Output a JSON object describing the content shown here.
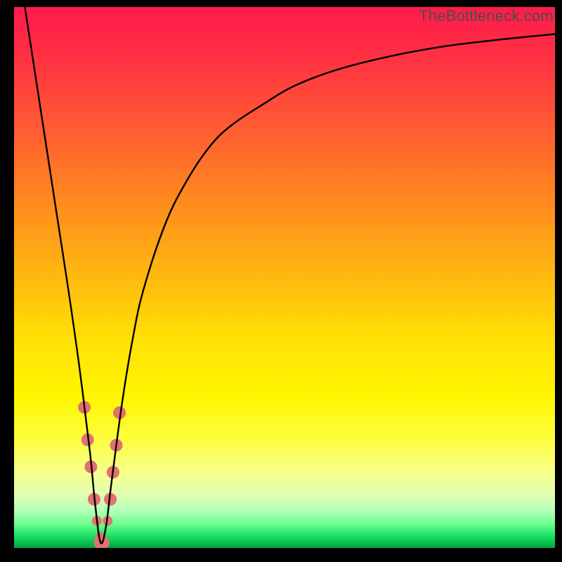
{
  "watermark": {
    "text": "TheBottleneck.com"
  },
  "colors": {
    "curve": "#000000",
    "marker": "#e37070",
    "markerStroke": "#d45a5a",
    "frame": "#000000"
  },
  "chart_data": {
    "type": "line",
    "title": "",
    "xlabel": "",
    "ylabel": "",
    "xlim": [
      0,
      100
    ],
    "ylim": [
      0,
      100
    ],
    "grid": false,
    "legend": null,
    "series": [
      {
        "name": "bottleneck-curve",
        "x": [
          2,
          4,
          6,
          8,
          10,
          12,
          14,
          15,
          16,
          17,
          18,
          20,
          22,
          24,
          28,
          32,
          36,
          40,
          46,
          52,
          60,
          70,
          80,
          90,
          100
        ],
        "y": [
          100,
          87,
          74,
          61,
          48,
          34,
          18,
          8,
          1,
          4,
          12,
          27,
          39,
          48,
          60,
          68,
          74,
          78,
          82,
          85.5,
          88.5,
          91,
          92.8,
          94,
          95
        ]
      }
    ],
    "markers": {
      "name": "highlight-dots",
      "x": [
        13.0,
        13.6,
        14.2,
        14.8,
        15.3,
        15.9,
        16.2,
        17.3,
        17.8,
        18.3,
        18.9,
        19.5
      ],
      "y": [
        26.0,
        20.0,
        15.0,
        9.0,
        5.0,
        2.0,
        1.0,
        5.0,
        9.0,
        14.0,
        19.0,
        25.0
      ],
      "radius": [
        9,
        9,
        9,
        9,
        7,
        7,
        11,
        7,
        9,
        9,
        9,
        9
      ]
    }
  }
}
